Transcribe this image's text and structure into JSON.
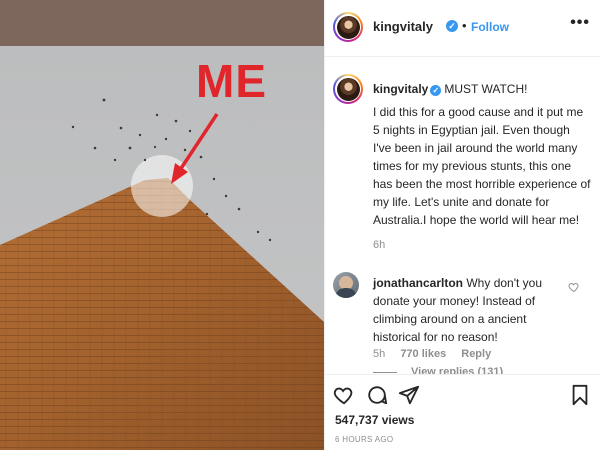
{
  "media": {
    "overlay_text": "ME"
  },
  "post": {
    "username": "kingvitaly",
    "verified": true,
    "separator": "•",
    "follow_label": "Follow",
    "more_icon": "more-horizontal-icon",
    "caption_head": "MUST WATCH!",
    "caption_text": "I did this for a good cause and it put me 5 nights in Egyptian jail. Even though I've been in jail around the world many times for my previous stunts, this one has been the most horrible experience of my life. Let's unite and donate for Australia.I hope the world will hear me!",
    "caption_time": "6h"
  },
  "comment": {
    "username": "jonathancarlton",
    "text": "Why don't you donate your money! Instead of climbing around on a ancient historical for no reason!",
    "time": "5h",
    "likes": "770 likes",
    "reply_label": "Reply",
    "view_replies": "View replies (131)"
  },
  "actions": {
    "like_icon": "heart-icon",
    "comment_icon": "comment-icon",
    "share_icon": "send-icon",
    "save_icon": "bookmark-icon"
  },
  "stats": {
    "views": "547,737 views",
    "posted_ago": "6 HOURS AGO"
  },
  "colors": {
    "link_blue": "#3897f0",
    "overlay_red": "#e0262a",
    "muted_gray": "#8e8e8e"
  }
}
